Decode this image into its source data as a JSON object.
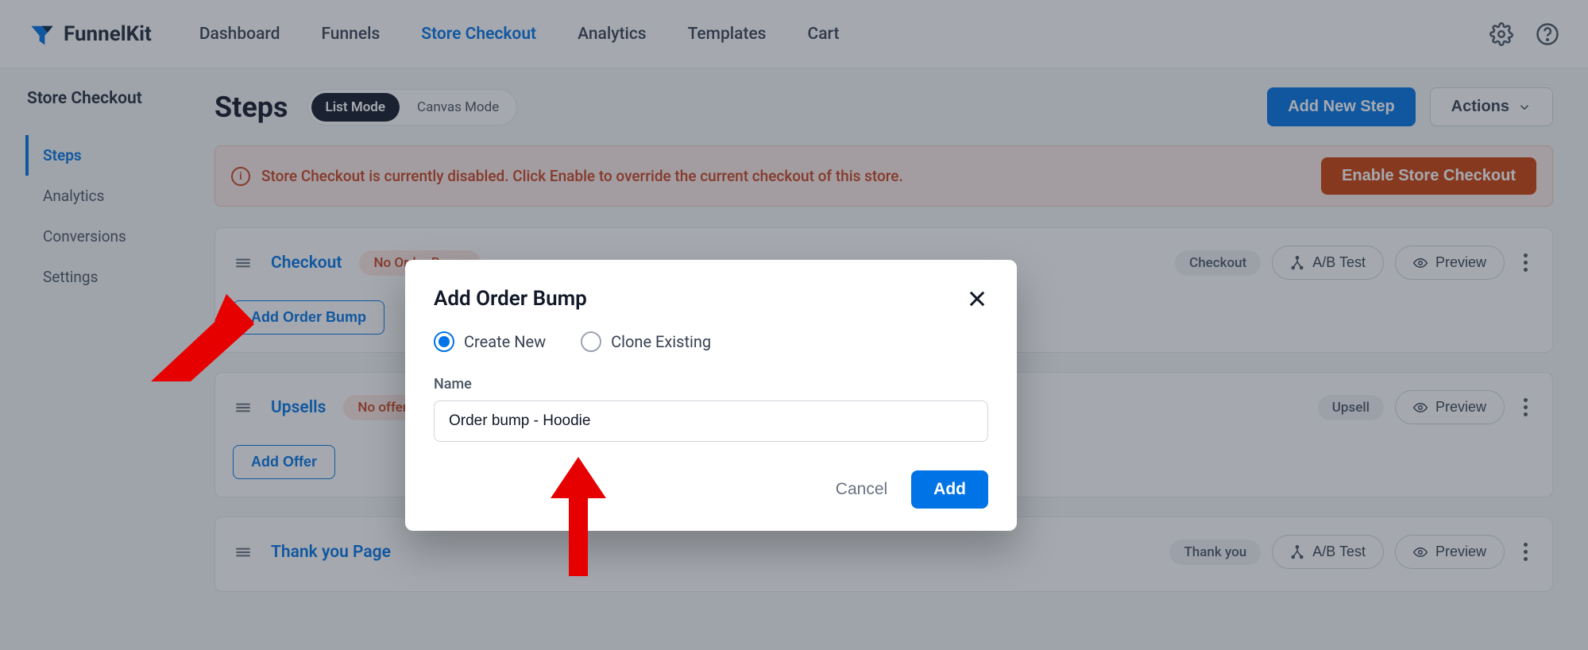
{
  "brand": "FunnelKit",
  "topnav": {
    "items": [
      "Dashboard",
      "Funnels",
      "Store Checkout",
      "Analytics",
      "Templates",
      "Cart"
    ],
    "activeIndex": 2
  },
  "sidebar": {
    "title": "Store Checkout",
    "items": [
      "Steps",
      "Analytics",
      "Conversions",
      "Settings"
    ],
    "activeIndex": 0
  },
  "page": {
    "title": "Steps",
    "modes": {
      "list": "List Mode",
      "canvas": "Canvas Mode"
    },
    "addNewStep": "Add New Step",
    "actions": "Actions"
  },
  "alert": {
    "text": "Store Checkout is currently disabled. Click Enable to override the current checkout of this store.",
    "cta": "Enable Store Checkout"
  },
  "steps": [
    {
      "name": "Checkout",
      "warn": "No Order Bump",
      "type": "Checkout",
      "abtest": true,
      "subAction": "Add Order Bump"
    },
    {
      "name": "Upsells",
      "warn": "No offer",
      "type": "Upsell",
      "abtest": false,
      "subAction": "Add Offer"
    },
    {
      "name": "Thank you Page",
      "warn": null,
      "type": "Thank you",
      "abtest": true,
      "subAction": null
    }
  ],
  "labels": {
    "abtest": "A/B Test",
    "preview": "Preview"
  },
  "modal": {
    "title": "Add Order Bump",
    "radio": {
      "create": "Create New",
      "clone": "Clone Existing"
    },
    "nameLabel": "Name",
    "nameValue": "Order bump - Hoodie",
    "cancel": "Cancel",
    "submit": "Add"
  }
}
